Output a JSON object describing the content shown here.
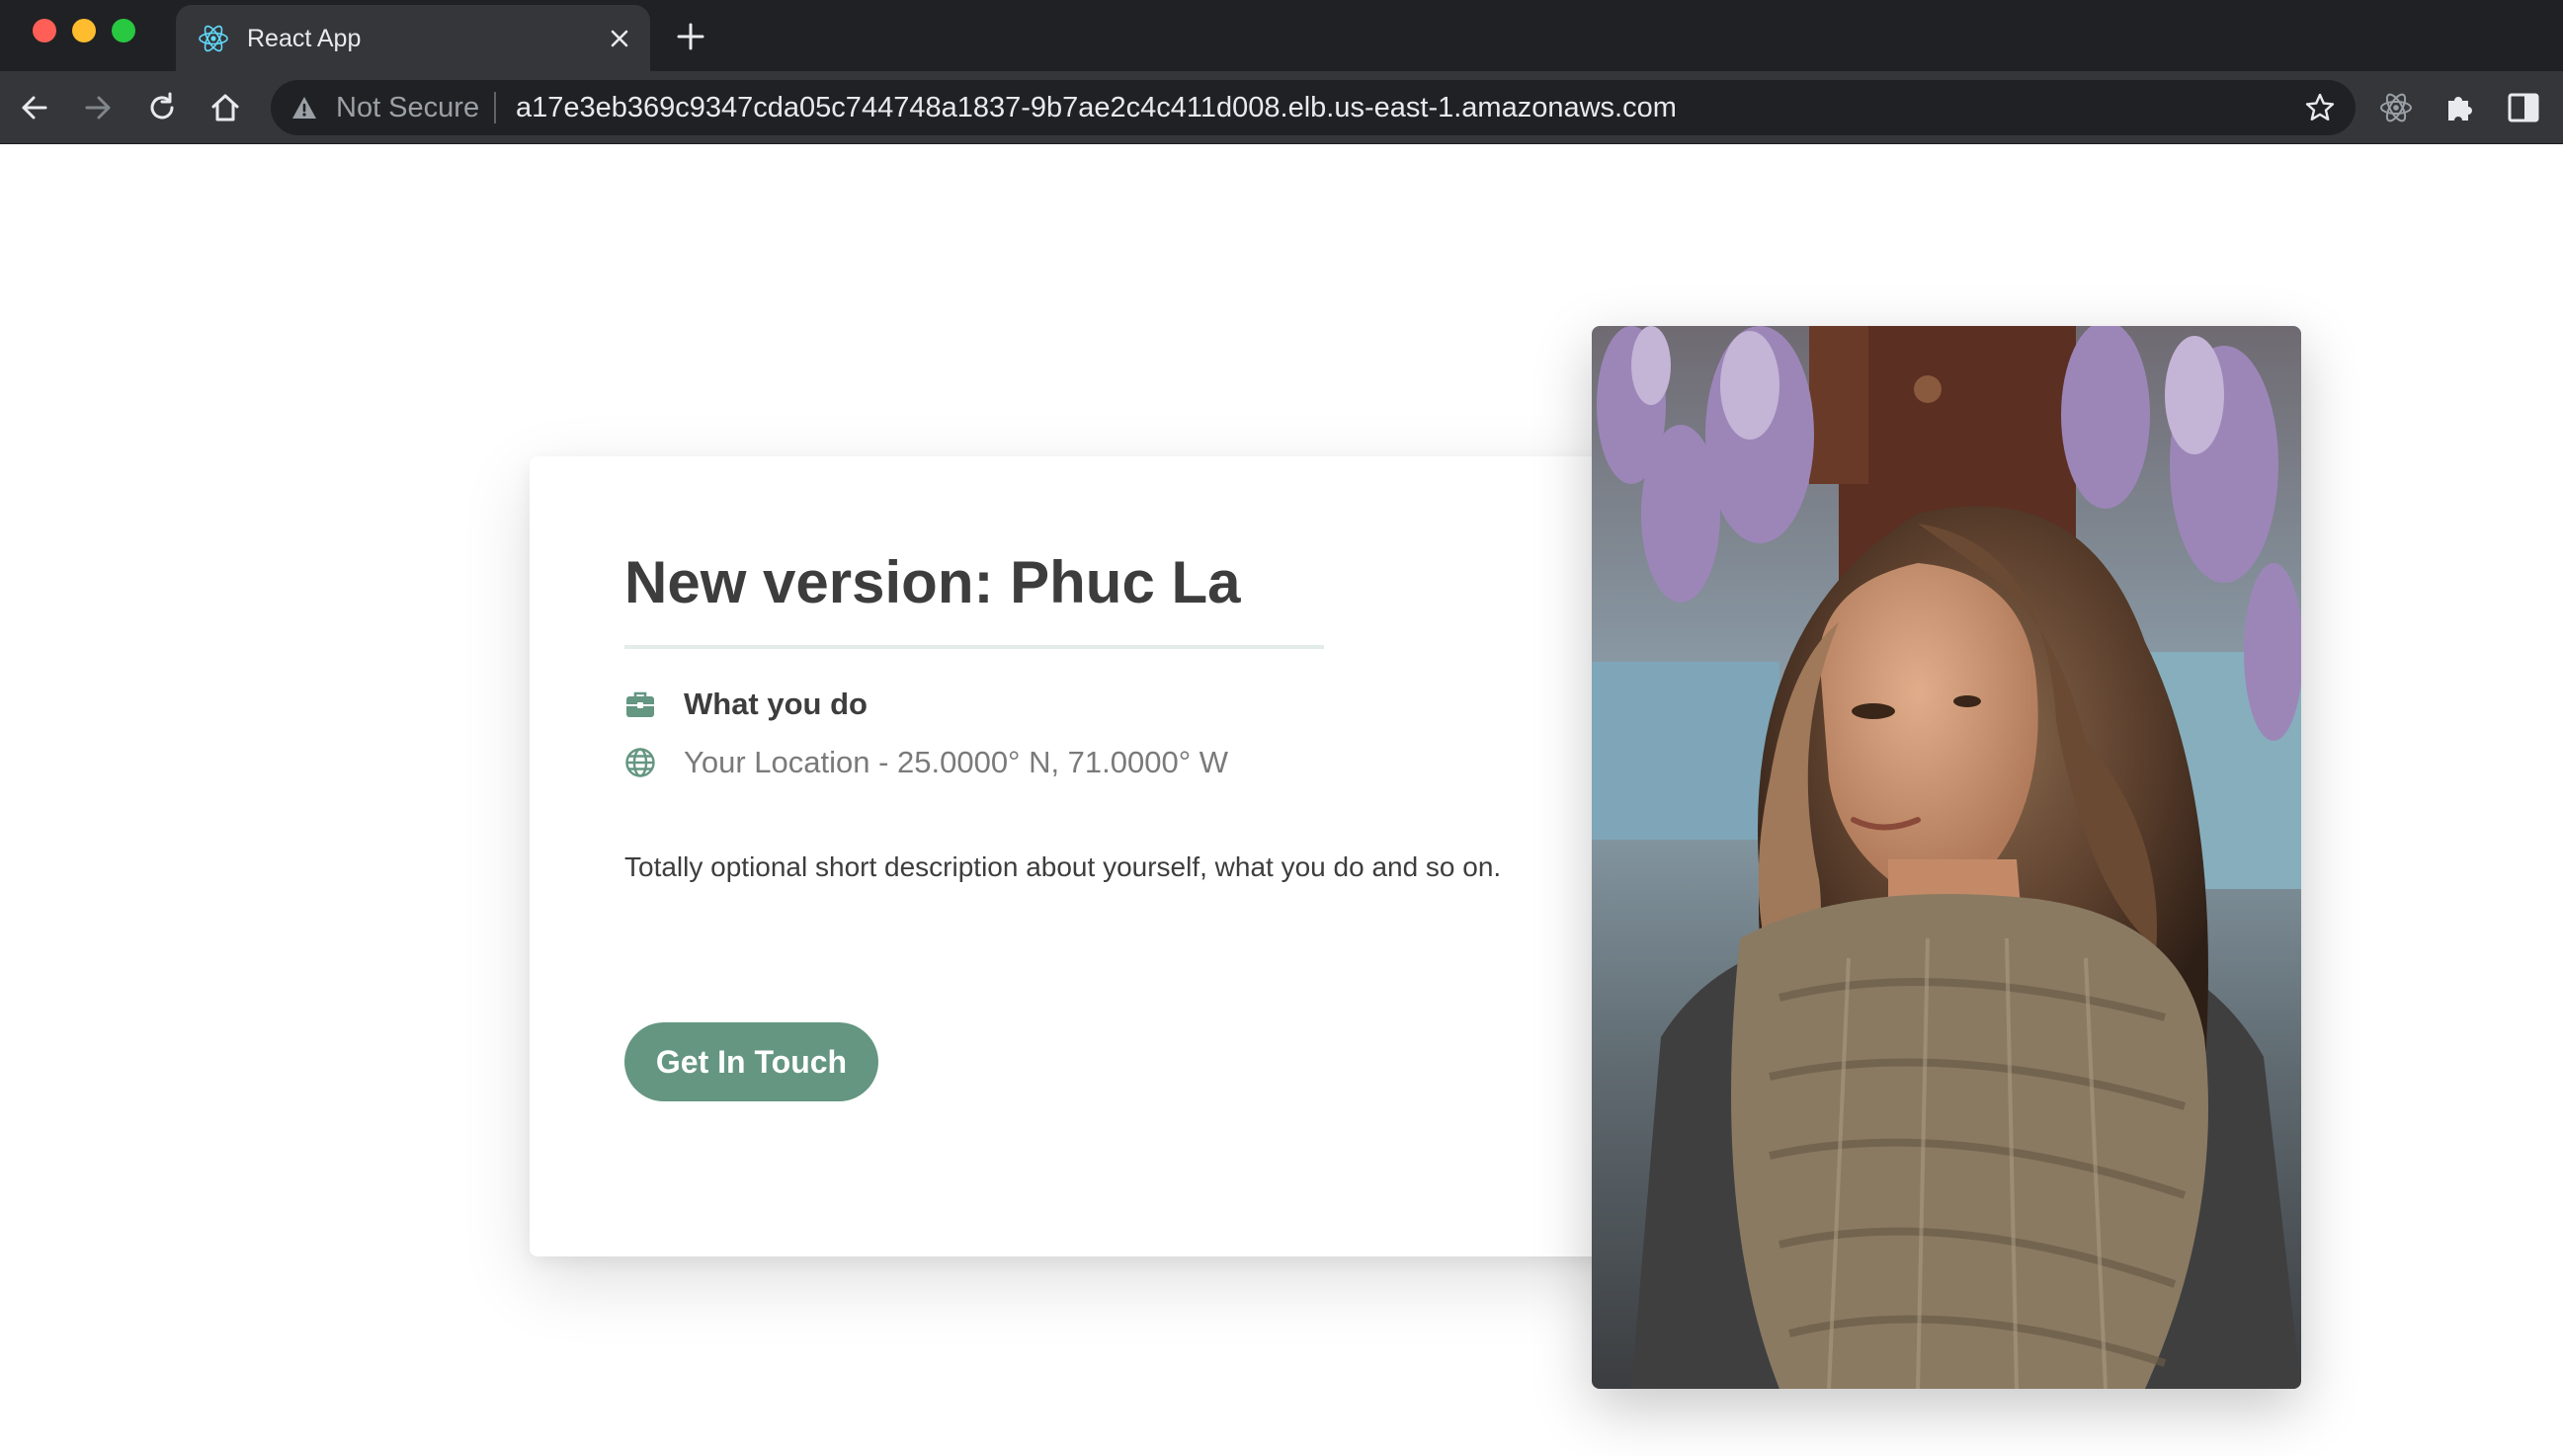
{
  "browser": {
    "tab": {
      "title": "React App",
      "favicon": "react-logo-icon"
    },
    "address_bar": {
      "security_label": "Not Secure",
      "url": "a17e3eb369c9347cda05c744748a1837-9b7ae2c4c411d008.elb.us-east-1.amazonaws.com"
    },
    "icons": [
      "back-icon",
      "forward-icon",
      "reload-icon",
      "home-icon",
      "warning-icon",
      "star-icon",
      "react-devtools-icon",
      "puzzle-icon",
      "side-panel-icon",
      "close-icon",
      "plus-icon"
    ]
  },
  "profile": {
    "name_heading": "New version: Phuc La",
    "job": "What you do",
    "location": "Your Location - 25.0000° N, 71.0000° W",
    "description": "Totally optional short description about yourself, what you do and so on.",
    "cta_label": "Get In Touch",
    "photo": "portrait-photo"
  },
  "colors": {
    "accent": "#649681",
    "heading_text": "#3d3d3d",
    "muted_text": "#7a7a7a",
    "chrome_dark": "#202124",
    "chrome_toolbar": "#35363a"
  }
}
